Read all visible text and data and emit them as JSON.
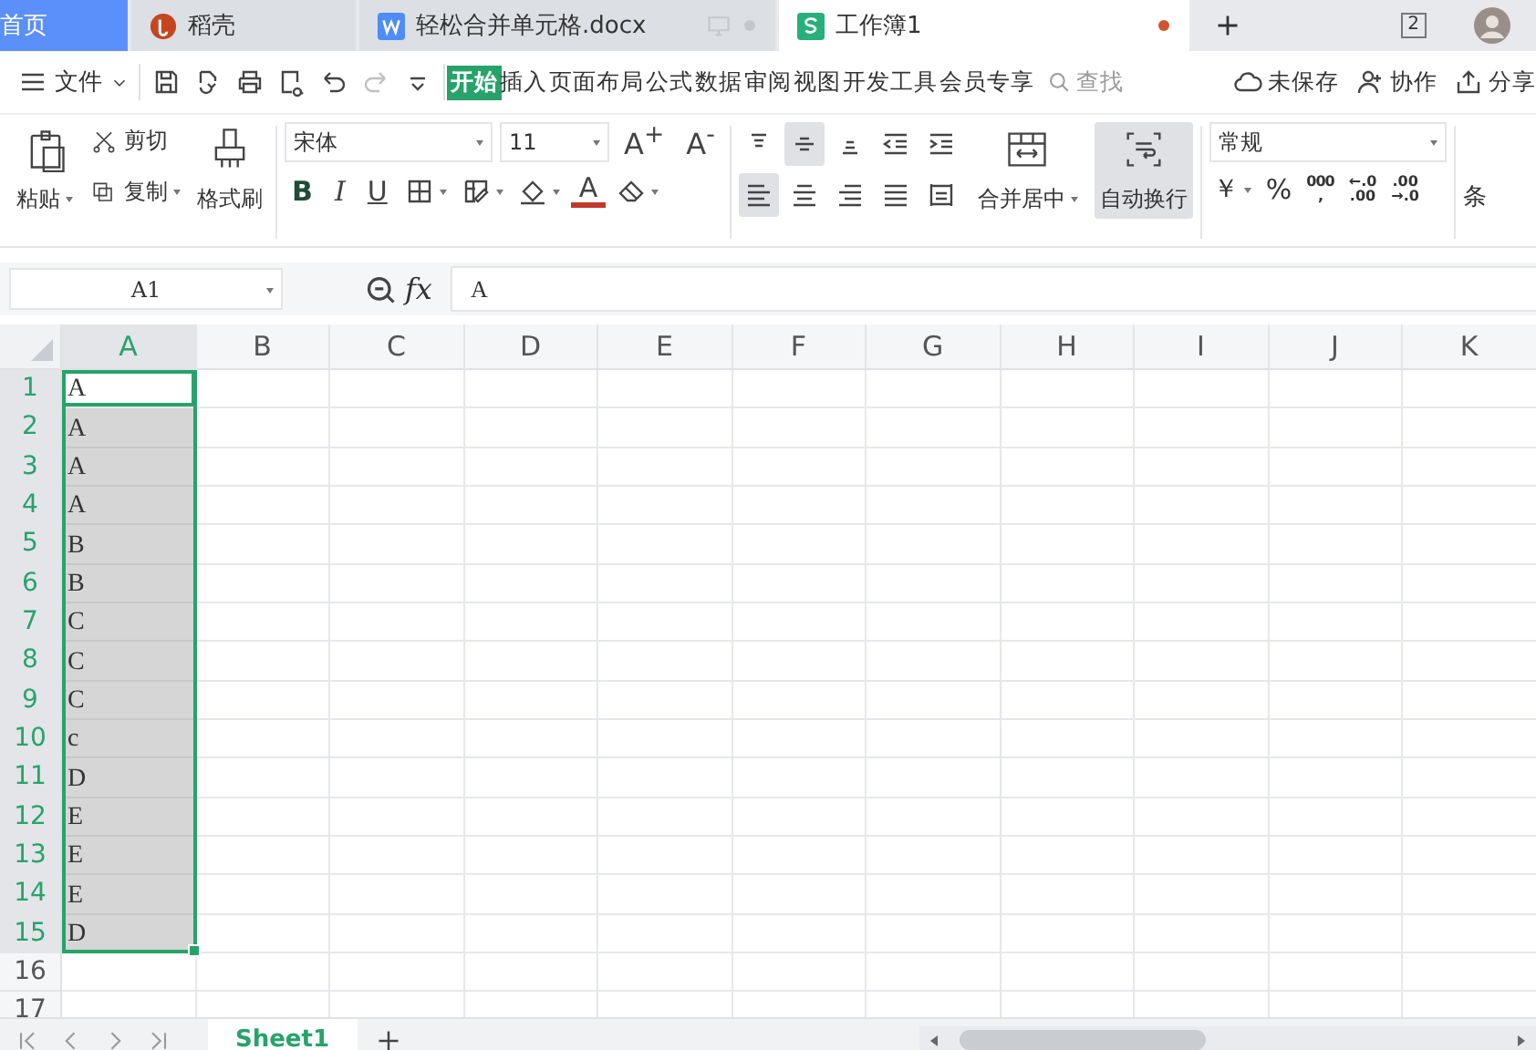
{
  "tabs": [
    {
      "kind": "home",
      "label": "首页",
      "selected": false
    },
    {
      "kind": "docer",
      "label": "稻壳",
      "selected": false
    },
    {
      "kind": "word",
      "label": "轻松合并单元格.docx",
      "selected": false
    },
    {
      "kind": "sheet",
      "label": "工作簿1",
      "selected": true,
      "unsaved": true
    }
  ],
  "window_count": "2",
  "menu": {
    "file": "文件",
    "quick_tools": [
      {
        "kind": "save",
        "disabled": false
      },
      {
        "kind": "export",
        "disabled": false
      },
      {
        "kind": "print",
        "disabled": false
      },
      {
        "kind": "preview",
        "disabled": false
      },
      {
        "kind": "undo",
        "disabled": false
      },
      {
        "kind": "redo",
        "disabled": true
      },
      {
        "kind": "more",
        "disabled": false
      }
    ],
    "items": [
      {
        "label": "开始",
        "selected": true
      },
      {
        "label": "插入",
        "selected": false
      },
      {
        "label": "页面布局",
        "selected": false
      },
      {
        "label": "公式",
        "selected": false
      },
      {
        "label": "数据",
        "selected": false
      },
      {
        "label": "审阅",
        "selected": false
      },
      {
        "label": "视图",
        "selected": false
      },
      {
        "label": "开发工具",
        "selected": false
      },
      {
        "label": "会员专享",
        "selected": false
      }
    ],
    "search": {
      "placeholder": "查找"
    },
    "actions": [
      {
        "kind": "cloud",
        "label": "未保存"
      },
      {
        "kind": "collab",
        "label": "协作"
      },
      {
        "kind": "share",
        "label": "分享"
      }
    ]
  },
  "ribbon": {
    "paste": "粘贴",
    "cut": "剪切",
    "copy": "复制",
    "format_painter": "格式刷",
    "font": "宋体",
    "font_size": "11",
    "grow": "A$^{+}$",
    "shrink": "A$^{-}$",
    "style_tools": [
      {
        "kind": "bold",
        "label": "B"
      },
      {
        "kind": "italic",
        "label": "I"
      },
      {
        "kind": "underline",
        "label": "U"
      },
      {
        "kind": "border"
      },
      {
        "kind": "cell-style"
      },
      {
        "kind": "fill"
      },
      {
        "kind": "font-color",
        "label": "A"
      },
      {
        "kind": "clear"
      }
    ],
    "align_tools": [
      {
        "kind": "align-top",
        "selected": false
      },
      {
        "kind": "align-middle",
        "selected": true
      },
      {
        "kind": "align-bottom",
        "selected": false
      },
      {
        "kind": "indent-less",
        "selected": false
      },
      {
        "kind": "indent-more",
        "selected": false
      },
      {
        "kind": "align-left",
        "selected": true
      },
      {
        "kind": "align-center",
        "selected": false
      },
      {
        "kind": "align-right",
        "selected": false
      },
      {
        "kind": "justify",
        "selected": false
      },
      {
        "kind": "distribute",
        "selected": false
      }
    ],
    "merge": "合并居中",
    "wrap": {
      "label": "自动换行",
      "selected": true
    },
    "number_format": "常规",
    "number_tools": [
      {
        "kind": "currency",
        "lines": [
          "￥"
        ]
      },
      {
        "kind": "percent",
        "lines": [
          "%"
        ]
      },
      {
        "kind": "thousands",
        "lines": [
          "000",
          ","
        ]
      },
      {
        "kind": "decimal-more",
        "lines": [
          "←.0",
          ".00"
        ]
      },
      {
        "kind": "decimal-less",
        "lines": [
          ".00",
          "→.0"
        ]
      }
    ],
    "next_group": "条"
  },
  "name_box": "A1",
  "fx": "fx",
  "formula": "A",
  "columns": [
    {
      "label": "A",
      "selected": true
    },
    {
      "label": "B",
      "selected": false
    },
    {
      "label": "C",
      "selected": false
    },
    {
      "label": "D",
      "selected": false
    },
    {
      "label": "E",
      "selected": false
    },
    {
      "label": "F",
      "selected": false
    },
    {
      "label": "G",
      "selected": false
    },
    {
      "label": "H",
      "selected": false
    },
    {
      "label": "I",
      "selected": false
    },
    {
      "label": "J",
      "selected": false
    },
    {
      "label": "K",
      "selected": false
    }
  ],
  "rows": [
    {
      "label": "1",
      "value": "A",
      "selected": true,
      "active": true
    },
    {
      "label": "2",
      "value": "A",
      "selected": true,
      "active": false
    },
    {
      "label": "3",
      "value": "A",
      "selected": true,
      "active": false
    },
    {
      "label": "4",
      "value": "A",
      "selected": true,
      "active": false
    },
    {
      "label": "5",
      "value": "B",
      "selected": true,
      "active": false
    },
    {
      "label": "6",
      "value": "B",
      "selected": true,
      "active": false
    },
    {
      "label": "7",
      "value": "C",
      "selected": true,
      "active": false
    },
    {
      "label": "8",
      "value": "C",
      "selected": true,
      "active": false
    },
    {
      "label": "9",
      "value": "C",
      "selected": true,
      "active": false
    },
    {
      "label": "10",
      "value": "c",
      "selected": true,
      "active": false
    },
    {
      "label": "11",
      "value": "D",
      "selected": true,
      "active": false
    },
    {
      "label": "12",
      "value": "E",
      "selected": true,
      "active": false
    },
    {
      "label": "13",
      "value": "E",
      "selected": true,
      "active": false
    },
    {
      "label": "14",
      "value": "E",
      "selected": true,
      "active": false
    },
    {
      "label": "15",
      "value": "D",
      "selected": true,
      "active": false
    },
    {
      "label": "16",
      "selected": false,
      "active": false
    },
    {
      "label": "17",
      "selected": false
    }
  ],
  "sheets": [
    {
      "label": "Sheet1",
      "selected": true
    }
  ]
}
